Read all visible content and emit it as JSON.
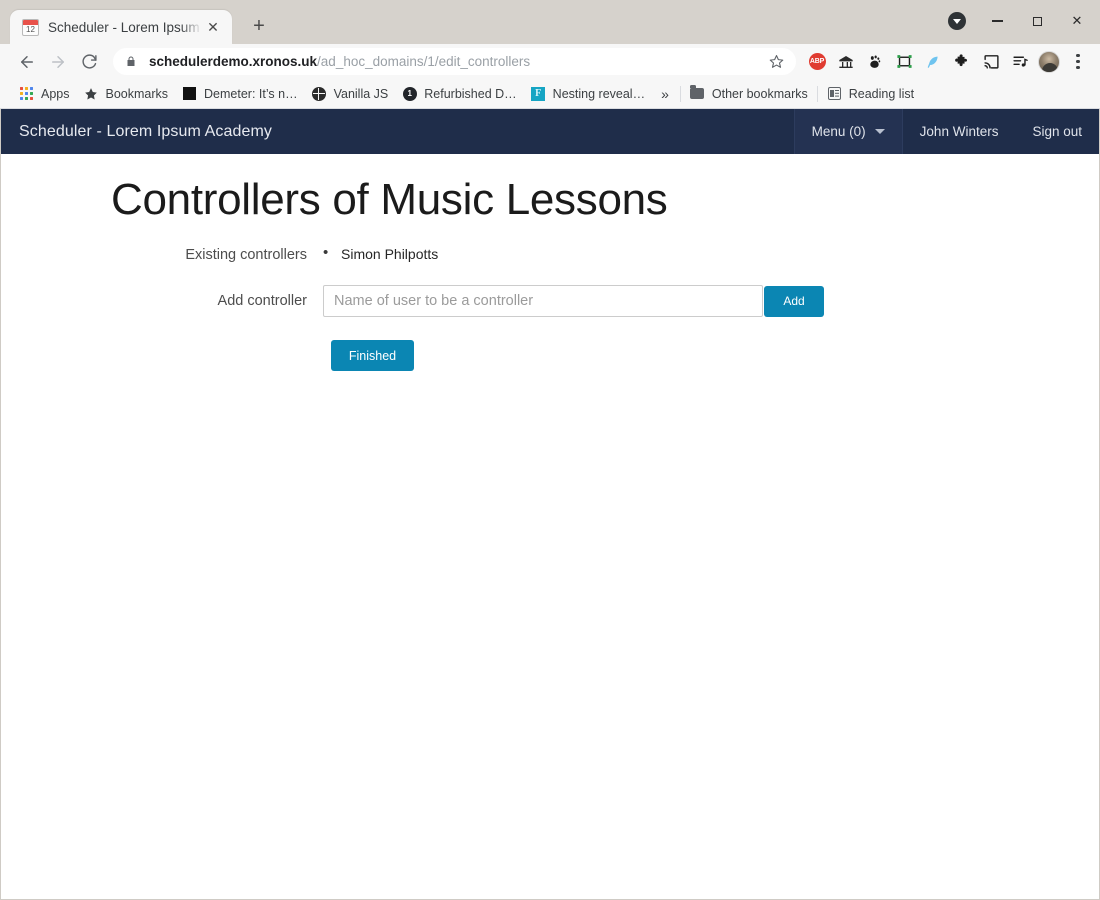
{
  "browser": {
    "tab": {
      "title": "Scheduler - Lorem Ipsum A",
      "favicon_name": "calendar-favicon",
      "favicon_number": "12",
      "close_label": "✕"
    },
    "new_tab_label": "+",
    "window_controls": {
      "download_name": "download-indicator",
      "minimize_label": "–",
      "maximize_label": "□",
      "close_label": "✕"
    },
    "toolbar": {
      "back_label": "←",
      "forward_label": "→",
      "reload_label": "⟳",
      "lock_name": "lock-icon",
      "url_host": "schedulerdemo.xronos.uk",
      "url_path": "/ad_hoc_domains/1/edit_controllers",
      "star_label": "☆",
      "extensions": [
        {
          "name": "adblock-plus-icon",
          "label": "ABP"
        },
        {
          "name": "bank-house-icon",
          "label": "🏦"
        },
        {
          "name": "gnome-footprint-icon",
          "label": "🐾"
        },
        {
          "name": "screenshot-capture-icon",
          "label": "⬚"
        },
        {
          "name": "feather-icon",
          "label": "🪶"
        },
        {
          "name": "puzzle-extensions-icon",
          "label": "🧩"
        },
        {
          "name": "cast-icon",
          "label": "📺"
        },
        {
          "name": "music-playlist-icon",
          "label": "♫"
        }
      ],
      "avatar_name": "profile-avatar",
      "menu_name": "chrome-menu-icon"
    },
    "bookmarks": [
      {
        "name": "bookmark-apps",
        "label": "Apps",
        "icon": "apps-grid-icon"
      },
      {
        "name": "bookmark-bookmarks",
        "label": "Bookmarks",
        "icon": "star-icon"
      },
      {
        "name": "bookmark-demeter",
        "label": "Demeter: It’s n…",
        "icon": "black-square-favicon"
      },
      {
        "name": "bookmark-vanilla-js",
        "label": "Vanilla JS",
        "icon": "globe-favicon"
      },
      {
        "name": "bookmark-refurbished",
        "label": "Refurbished D…",
        "icon": "dark-circle-favicon"
      },
      {
        "name": "bookmark-nesting",
        "label": "Nesting reveal…",
        "icon": "teal-f-favicon"
      }
    ],
    "bookmarks_overflow_label": "»",
    "other_bookmarks_label": "Other bookmarks",
    "reading_list_label": "Reading list"
  },
  "app": {
    "brand": "Scheduler - Lorem Ipsum Academy",
    "nav": {
      "menu_label": "Menu (0)",
      "user_label": "John Winters",
      "signout_label": "Sign out"
    },
    "page_title": "Controllers of Music Lessons",
    "existing": {
      "label": "Existing controllers",
      "items": [
        "Simon Philpotts"
      ]
    },
    "add": {
      "label": "Add controller",
      "input_value": "",
      "input_placeholder": "Name of user to be a controller",
      "button_label": "Add"
    },
    "finished_button_label": "Finished",
    "colors": {
      "navbar": "#1f2d4a",
      "accent_blue": "#0b86b3",
      "page_bg": "#ffffff"
    }
  }
}
